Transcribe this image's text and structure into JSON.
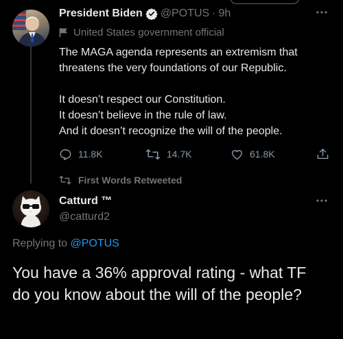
{
  "tweet1": {
    "author_name": "President Biden",
    "handle": "@POTUS",
    "separator": "·",
    "time": "9h",
    "label": "United States government official",
    "text": "The MAGA agenda represents an extremism that\nthreatens the very foundations of our Republic.\n\nIt doesn’t respect our Constitution.\nIt doesn’t believe in the rule of law.\nAnd it doesn’t recognize the will of the people.",
    "replies": "11.8K",
    "retweets": "14.7K",
    "likes": "61.8K"
  },
  "retweet_label": "First Words Retweeted",
  "tweet2": {
    "author_name": "Catturd ™",
    "handle": "@catturd2",
    "replying_to_prefix": "Replying to",
    "replying_to_handle": "@POTUS",
    "text": "You have a 36% approval rating - what TF do you know about the will of the people?"
  },
  "colors": {
    "background": "#000000",
    "text": "#e7e9ea",
    "muted": "#71767b",
    "link": "#1d9bf0",
    "verified_badge": "#e7e9ea"
  }
}
